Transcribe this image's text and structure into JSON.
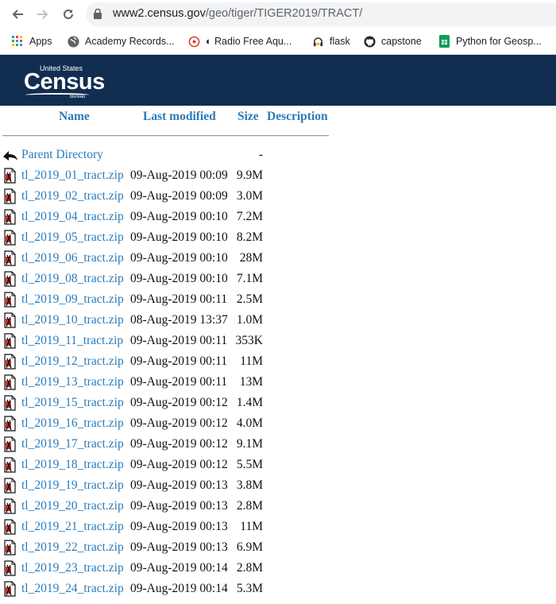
{
  "browser": {
    "url_host": "www2.census.gov",
    "url_path": "/geo/tiger/TIGER2019/TRACT/"
  },
  "bookmarks": [
    {
      "label": "Apps",
      "icon": "apps-grid-icon"
    },
    {
      "label": "Academy Records...",
      "icon": "globe-icon"
    },
    {
      "label": "◐ Radio Free Aqu...",
      "icon": "radio-target-icon"
    },
    {
      "label": "flask",
      "icon": "flask-headphones-icon"
    },
    {
      "label": "capstone",
      "icon": "github-icon"
    },
    {
      "label": "Python for Geosp...",
      "icon": "sheets-icon"
    }
  ],
  "banner": {
    "logo_top": "United States",
    "logo_main": "Census",
    "logo_bottom": "Bureau",
    "color": "#112e51"
  },
  "listing": {
    "headers": {
      "name": "Name",
      "modified": "Last modified",
      "size": "Size",
      "description": "Description"
    },
    "parent": {
      "name": "Parent Directory",
      "size": "-"
    },
    "rows": [
      {
        "name": "tl_2019_01_tract.zip",
        "modified": "09-Aug-2019 00:09",
        "size": "9.9M"
      },
      {
        "name": "tl_2019_02_tract.zip",
        "modified": "09-Aug-2019 00:09",
        "size": "3.0M"
      },
      {
        "name": "tl_2019_04_tract.zip",
        "modified": "09-Aug-2019 00:10",
        "size": "7.2M"
      },
      {
        "name": "tl_2019_05_tract.zip",
        "modified": "09-Aug-2019 00:10",
        "size": "8.2M"
      },
      {
        "name": "tl_2019_06_tract.zip",
        "modified": "09-Aug-2019 00:10",
        "size": "28M"
      },
      {
        "name": "tl_2019_08_tract.zip",
        "modified": "09-Aug-2019 00:10",
        "size": "7.1M"
      },
      {
        "name": "tl_2019_09_tract.zip",
        "modified": "09-Aug-2019 00:11",
        "size": "2.5M"
      },
      {
        "name": "tl_2019_10_tract.zip",
        "modified": "08-Aug-2019 13:37",
        "size": "1.0M"
      },
      {
        "name": "tl_2019_11_tract.zip",
        "modified": "09-Aug-2019 00:11",
        "size": "353K"
      },
      {
        "name": "tl_2019_12_tract.zip",
        "modified": "09-Aug-2019 00:11",
        "size": "11M"
      },
      {
        "name": "tl_2019_13_tract.zip",
        "modified": "09-Aug-2019 00:11",
        "size": "13M"
      },
      {
        "name": "tl_2019_15_tract.zip",
        "modified": "09-Aug-2019 00:12",
        "size": "1.4M"
      },
      {
        "name": "tl_2019_16_tract.zip",
        "modified": "09-Aug-2019 00:12",
        "size": "4.0M"
      },
      {
        "name": "tl_2019_17_tract.zip",
        "modified": "09-Aug-2019 00:12",
        "size": "9.1M"
      },
      {
        "name": "tl_2019_18_tract.zip",
        "modified": "09-Aug-2019 00:12",
        "size": "5.5M"
      },
      {
        "name": "tl_2019_19_tract.zip",
        "modified": "09-Aug-2019 00:13",
        "size": "3.8M"
      },
      {
        "name": "tl_2019_20_tract.zip",
        "modified": "09-Aug-2019 00:13",
        "size": "2.8M"
      },
      {
        "name": "tl_2019_21_tract.zip",
        "modified": "09-Aug-2019 00:13",
        "size": "11M"
      },
      {
        "name": "tl_2019_22_tract.zip",
        "modified": "09-Aug-2019 00:13",
        "size": "6.9M"
      },
      {
        "name": "tl_2019_23_tract.zip",
        "modified": "09-Aug-2019 00:14",
        "size": "2.8M"
      },
      {
        "name": "tl_2019_24_tract.zip",
        "modified": "09-Aug-2019 00:14",
        "size": "5.3M"
      }
    ]
  }
}
